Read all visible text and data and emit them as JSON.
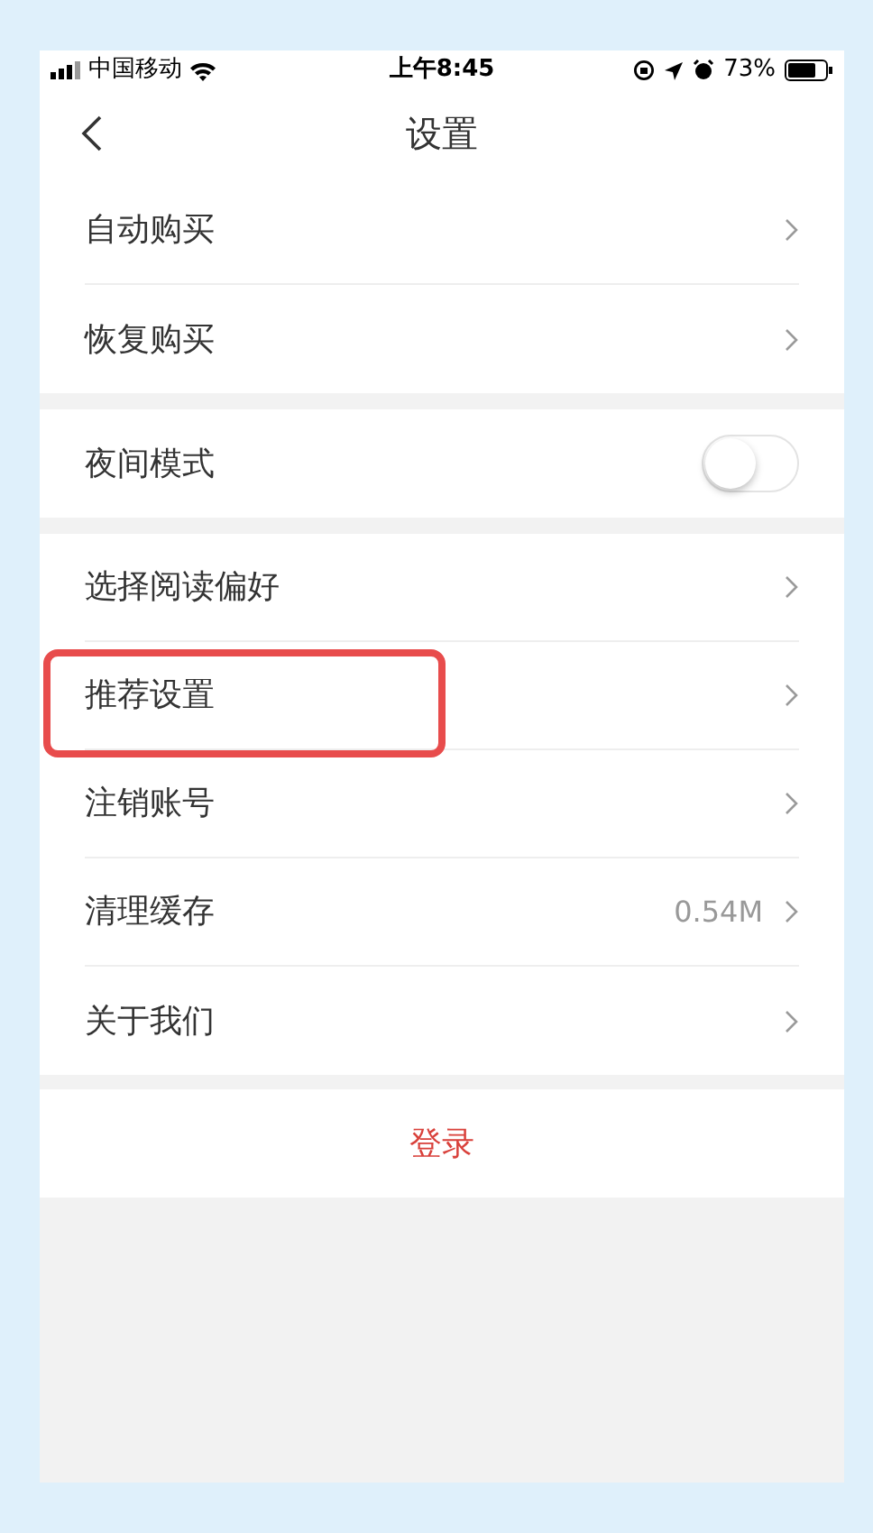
{
  "status_bar": {
    "carrier": "中国移动",
    "time": "上午8:45",
    "battery": "73%"
  },
  "nav": {
    "title": "设置"
  },
  "sections": [
    {
      "items": [
        {
          "kind": "link",
          "label": "自动购买",
          "highlighted": false
        },
        {
          "kind": "link",
          "label": "恢复购买",
          "highlighted": false
        }
      ]
    },
    {
      "items": [
        {
          "kind": "toggle",
          "label": "夜间模式",
          "on": false,
          "highlighted": false
        }
      ]
    },
    {
      "items": [
        {
          "kind": "link",
          "label": "选择阅读偏好",
          "highlighted": false
        },
        {
          "kind": "link",
          "label": "推荐设置",
          "highlighted": true
        },
        {
          "kind": "link",
          "label": "注销账号",
          "highlighted": false
        },
        {
          "kind": "link",
          "label": "清理缓存",
          "value": "0.54M",
          "highlighted": false
        },
        {
          "kind": "link",
          "label": "关于我们",
          "highlighted": false
        }
      ]
    }
  ],
  "login_button": "登录"
}
